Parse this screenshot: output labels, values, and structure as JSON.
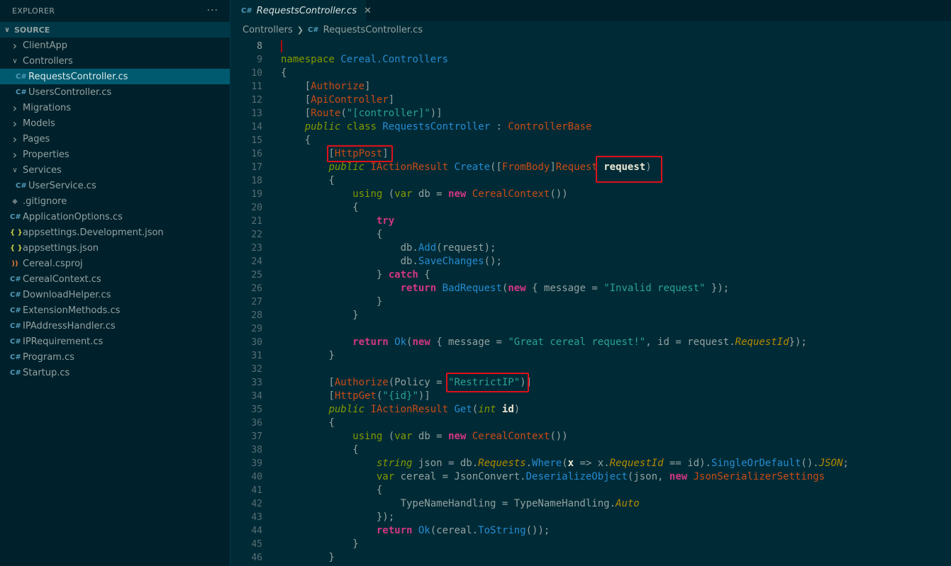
{
  "sidebar": {
    "title": "EXPLORER",
    "menu_glyph": "···",
    "section": "SOURCE",
    "items": [
      {
        "label": "ClientApp",
        "type": "folder",
        "open": false,
        "depth": 1
      },
      {
        "label": "Controllers",
        "type": "folder",
        "open": true,
        "depth": 1
      },
      {
        "label": "RequestsController.cs",
        "type": "cs",
        "depth": 2,
        "selected": true
      },
      {
        "label": "UsersController.cs",
        "type": "cs",
        "depth": 2
      },
      {
        "label": "Migrations",
        "type": "folder",
        "open": false,
        "depth": 1
      },
      {
        "label": "Models",
        "type": "folder",
        "open": false,
        "depth": 1
      },
      {
        "label": "Pages",
        "type": "folder",
        "open": false,
        "depth": 1
      },
      {
        "label": "Properties",
        "type": "folder",
        "open": false,
        "depth": 1
      },
      {
        "label": "Services",
        "type": "folder",
        "open": true,
        "depth": 1
      },
      {
        "label": "UserService.cs",
        "type": "cs",
        "depth": 2
      },
      {
        "label": ".gitignore",
        "type": "git",
        "depth": 1
      },
      {
        "label": "ApplicationOptions.cs",
        "type": "cs",
        "depth": 1
      },
      {
        "label": "appsettings.Development.json",
        "type": "json",
        "depth": 1
      },
      {
        "label": "appsettings.json",
        "type": "json",
        "depth": 1
      },
      {
        "label": "Cereal.csproj",
        "type": "rss",
        "depth": 1
      },
      {
        "label": "CerealContext.cs",
        "type": "cs",
        "depth": 1
      },
      {
        "label": "DownloadHelper.cs",
        "type": "cs",
        "depth": 1
      },
      {
        "label": "ExtensionMethods.cs",
        "type": "cs",
        "depth": 1
      },
      {
        "label": "IPAddressHandler.cs",
        "type": "cs",
        "depth": 1
      },
      {
        "label": "IPRequirement.cs",
        "type": "cs",
        "depth": 1
      },
      {
        "label": "Program.cs",
        "type": "cs",
        "depth": 1
      },
      {
        "label": "Startup.cs",
        "type": "cs",
        "depth": 1
      }
    ]
  },
  "tab": {
    "label": "RequestsController.cs",
    "close": "✕",
    "icon": "C#"
  },
  "breadcrumb": {
    "folder": "Controllers",
    "file": "RequestsController.cs"
  },
  "editor": {
    "active_line": 8,
    "lines": [
      {
        "n": 8,
        "tokens": []
      },
      {
        "n": 9,
        "tokens": [
          [
            "k",
            "namespace "
          ],
          [
            "t",
            "Cereal.Controllers"
          ]
        ]
      },
      {
        "n": 10,
        "tokens": [
          [
            "pu",
            "{"
          ]
        ]
      },
      {
        "n": 11,
        "tokens": [
          [
            "pu",
            "    ["
          ],
          [
            "at",
            "Authorize"
          ],
          [
            "pu",
            "]"
          ]
        ]
      },
      {
        "n": 12,
        "tokens": [
          [
            "pu",
            "    ["
          ],
          [
            "at",
            "ApiController"
          ],
          [
            "pu",
            "]"
          ]
        ]
      },
      {
        "n": 13,
        "tokens": [
          [
            "pu",
            "    ["
          ],
          [
            "at",
            "Route"
          ],
          [
            "pu",
            "("
          ],
          [
            "s",
            "\"[controller]\""
          ],
          [
            "pu",
            ")]"
          ]
        ]
      },
      {
        "n": 14,
        "tokens": [
          [
            "pu",
            "    "
          ],
          [
            "ki",
            "public "
          ],
          [
            "k",
            "class "
          ],
          [
            "t",
            "RequestsController "
          ],
          [
            "pu",
            ": "
          ],
          [
            "ty",
            "ControllerBase"
          ]
        ]
      },
      {
        "n": 15,
        "tokens": [
          [
            "pu",
            "    {"
          ]
        ]
      },
      {
        "n": 16,
        "tokens": [
          [
            "pu",
            "        ["
          ],
          [
            "at",
            "HttpPost"
          ],
          [
            "pu",
            "]"
          ]
        ]
      },
      {
        "n": 17,
        "tokens": [
          [
            "pu",
            "        "
          ],
          [
            "ki",
            "public "
          ],
          [
            "ty",
            "IActionResult "
          ],
          [
            "f",
            "Create"
          ],
          [
            "pu",
            "(["
          ],
          [
            "at",
            "FromBody"
          ],
          [
            "pu",
            "]"
          ],
          [
            "ty",
            "Request "
          ],
          [
            "bold",
            "request"
          ],
          [
            "pu",
            ")"
          ]
        ]
      },
      {
        "n": 18,
        "tokens": [
          [
            "pu",
            "        {"
          ]
        ]
      },
      {
        "n": 19,
        "tokens": [
          [
            "pu",
            "            "
          ],
          [
            "k",
            "using "
          ],
          [
            "pu",
            "("
          ],
          [
            "k",
            "var "
          ],
          [
            "pu",
            "db = "
          ],
          [
            "kb",
            "new "
          ],
          [
            "ty",
            "CerealContext"
          ],
          [
            "pu",
            "())"
          ]
        ]
      },
      {
        "n": 20,
        "tokens": [
          [
            "pu",
            "            {"
          ]
        ]
      },
      {
        "n": 21,
        "tokens": [
          [
            "pu",
            "                "
          ],
          [
            "kb",
            "try"
          ]
        ]
      },
      {
        "n": 22,
        "tokens": [
          [
            "pu",
            "                {"
          ]
        ]
      },
      {
        "n": 23,
        "tokens": [
          [
            "pu",
            "                    db."
          ],
          [
            "f",
            "Add"
          ],
          [
            "pu",
            "(request);"
          ]
        ]
      },
      {
        "n": 24,
        "tokens": [
          [
            "pu",
            "                    db."
          ],
          [
            "f",
            "SaveChanges"
          ],
          [
            "pu",
            "();"
          ]
        ]
      },
      {
        "n": 25,
        "tokens": [
          [
            "pu",
            "                } "
          ],
          [
            "kb",
            "catch "
          ],
          [
            "pu",
            "{"
          ]
        ]
      },
      {
        "n": 26,
        "tokens": [
          [
            "pu",
            "                    "
          ],
          [
            "kb",
            "return "
          ],
          [
            "f",
            "BadRequest"
          ],
          [
            "pu",
            "("
          ],
          [
            "kb",
            "new "
          ],
          [
            "pu",
            "{ message = "
          ],
          [
            "s",
            "\"Invalid request\""
          ],
          [
            "pu",
            " });"
          ]
        ]
      },
      {
        "n": 27,
        "tokens": [
          [
            "pu",
            "                }"
          ]
        ]
      },
      {
        "n": 28,
        "tokens": [
          [
            "pu",
            "            }"
          ]
        ]
      },
      {
        "n": 29,
        "tokens": []
      },
      {
        "n": 30,
        "tokens": [
          [
            "pu",
            "            "
          ],
          [
            "kb",
            "return "
          ],
          [
            "f",
            "Ok"
          ],
          [
            "pu",
            "("
          ],
          [
            "kb",
            "new "
          ],
          [
            "pu",
            "{ message = "
          ],
          [
            "s",
            "\"Great cereal request!\""
          ],
          [
            "pu",
            ", id = request."
          ],
          [
            "itprop",
            "RequestId"
          ],
          [
            "pu",
            "});"
          ]
        ]
      },
      {
        "n": 31,
        "tokens": [
          [
            "pu",
            "        }"
          ]
        ]
      },
      {
        "n": 32,
        "tokens": []
      },
      {
        "n": 33,
        "tokens": [
          [
            "pu",
            "        ["
          ],
          [
            "at",
            "Authorize"
          ],
          [
            "pu",
            "(Policy = "
          ],
          [
            "s",
            "\"RestrictIP\""
          ],
          [
            "pu",
            ")]"
          ]
        ]
      },
      {
        "n": 34,
        "tokens": [
          [
            "pu",
            "        ["
          ],
          [
            "at",
            "HttpGet"
          ],
          [
            "pu",
            "("
          ],
          [
            "s",
            "\"{id}\""
          ],
          [
            "pu",
            ")]"
          ]
        ]
      },
      {
        "n": 35,
        "tokens": [
          [
            "pu",
            "        "
          ],
          [
            "ki",
            "public "
          ],
          [
            "ty",
            "IActionResult "
          ],
          [
            "f",
            "Get"
          ],
          [
            "pu",
            "("
          ],
          [
            "ki",
            "int "
          ],
          [
            "bold",
            "id"
          ],
          [
            "pu",
            ")"
          ]
        ]
      },
      {
        "n": 36,
        "tokens": [
          [
            "pu",
            "        {"
          ]
        ]
      },
      {
        "n": 37,
        "tokens": [
          [
            "pu",
            "            "
          ],
          [
            "k",
            "using "
          ],
          [
            "pu",
            "("
          ],
          [
            "k",
            "var "
          ],
          [
            "pu",
            "db = "
          ],
          [
            "kb",
            "new "
          ],
          [
            "ty",
            "CerealContext"
          ],
          [
            "pu",
            "())"
          ]
        ]
      },
      {
        "n": 38,
        "tokens": [
          [
            "pu",
            "            {"
          ]
        ]
      },
      {
        "n": 39,
        "tokens": [
          [
            "pu",
            "                "
          ],
          [
            "ki",
            "string "
          ],
          [
            "pu",
            "json = db."
          ],
          [
            "itprop",
            "Requests"
          ],
          [
            "pu",
            "."
          ],
          [
            "f",
            "Where"
          ],
          [
            "pu",
            "("
          ],
          [
            "bold",
            "x"
          ],
          [
            "pu",
            " => x."
          ],
          [
            "itprop",
            "RequestId"
          ],
          [
            "pu",
            " == id)."
          ],
          [
            "f",
            "SingleOrDefault"
          ],
          [
            "pu",
            "()."
          ],
          [
            "itprop",
            "JSON"
          ],
          [
            "pu",
            ";"
          ]
        ]
      },
      {
        "n": 40,
        "tokens": [
          [
            "pu",
            "                "
          ],
          [
            "k",
            "var "
          ],
          [
            "pu",
            "cereal = JsonConvert."
          ],
          [
            "f",
            "DeserializeObject"
          ],
          [
            "pu",
            "(json, "
          ],
          [
            "kb",
            "new "
          ],
          [
            "ty",
            "JsonSerializerSettings"
          ]
        ]
      },
      {
        "n": 41,
        "tokens": [
          [
            "pu",
            "                {"
          ]
        ]
      },
      {
        "n": 42,
        "tokens": [
          [
            "pu",
            "                    TypeNameHandling = TypeNameHandling."
          ],
          [
            "itprop",
            "Auto"
          ]
        ]
      },
      {
        "n": 43,
        "tokens": [
          [
            "pu",
            "                });"
          ]
        ]
      },
      {
        "n": 44,
        "tokens": [
          [
            "pu",
            "                "
          ],
          [
            "kb",
            "return "
          ],
          [
            "f",
            "Ok"
          ],
          [
            "pu",
            "(cereal."
          ],
          [
            "f",
            "ToString"
          ],
          [
            "pu",
            "());"
          ]
        ]
      },
      {
        "n": 45,
        "tokens": [
          [
            "pu",
            "            }"
          ]
        ]
      },
      {
        "n": 46,
        "tokens": [
          [
            "pu",
            "        }"
          ]
        ]
      }
    ]
  }
}
